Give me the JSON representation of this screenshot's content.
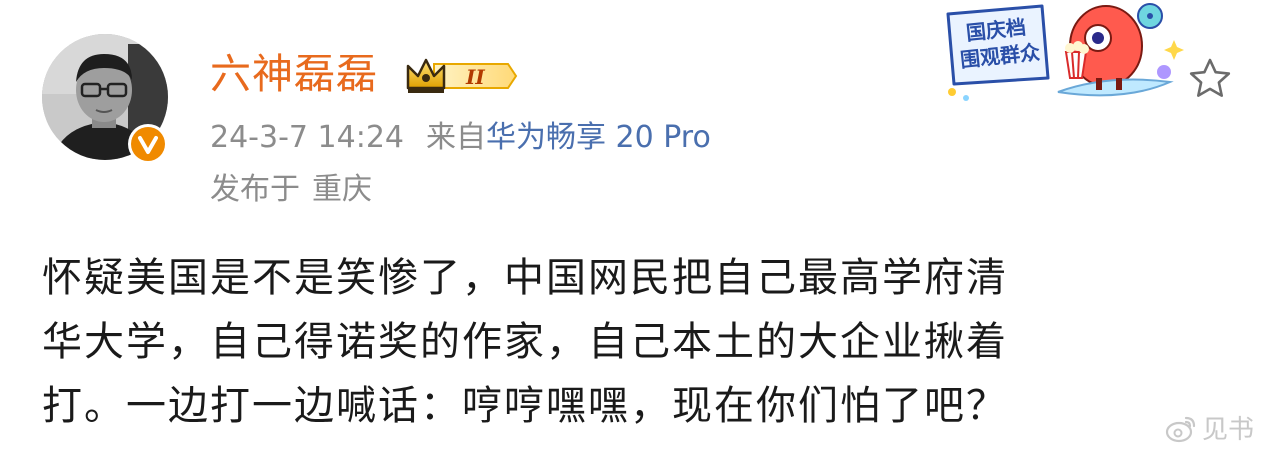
{
  "user": {
    "name": "六神磊磊",
    "level_badge_text": "II"
  },
  "meta": {
    "timestamp": "24-3-7 14:24",
    "source_prefix": "来自",
    "source_device": "华为畅享 20 Pro",
    "location_prefix": "发布于",
    "location": "重庆"
  },
  "promo": {
    "line1": "国庆档",
    "line2": "围观群众"
  },
  "post": {
    "lines": [
      "怀疑美国是不是笑惨了，中国网民把自己最高学府清",
      "华大学，自己得诺奖的作家，自己本土的大企业揪着",
      "打。一边打一边喊话：哼哼嘿嘿，现在你们怕了吧？"
    ]
  },
  "watermark": {
    "text": "见书"
  },
  "colors": {
    "username": "#e86a1d",
    "meta": "#8c8c8c",
    "link": "#4a6fae",
    "body": "#1a1a1a",
    "verified": "#f08a00"
  },
  "icons": {
    "avatar": "avatar",
    "verified": "verified-v-icon",
    "level": "crown-level-icon",
    "favorite": "star-outline-icon",
    "watermark": "weibo-icon"
  }
}
